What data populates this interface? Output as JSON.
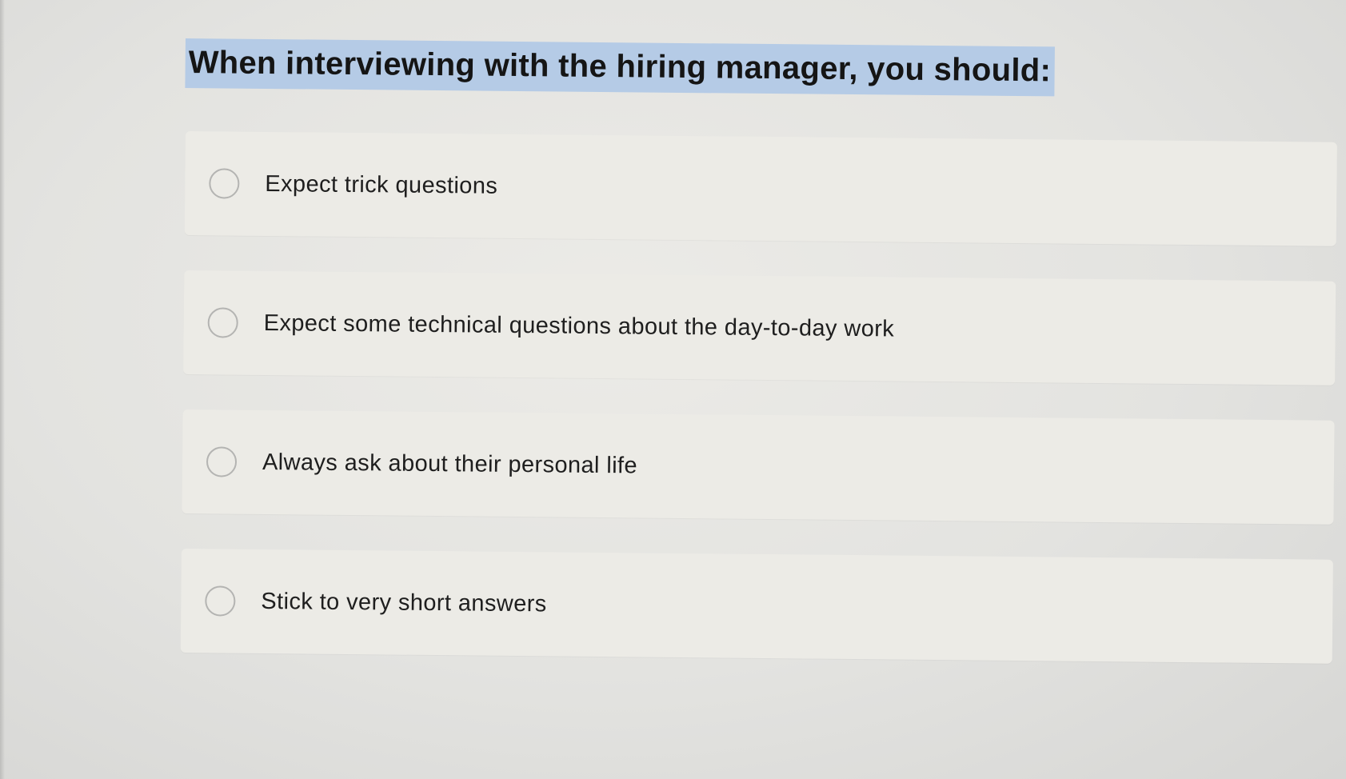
{
  "question": {
    "text": "When interviewing with the hiring manager, you should:"
  },
  "options": [
    {
      "label": "Expect trick questions",
      "selected": false
    },
    {
      "label": "Expect some technical questions about the day-to-day work",
      "selected": false
    },
    {
      "label": "Always ask about their personal life",
      "selected": false
    },
    {
      "label": "Stick to very short answers",
      "selected": false
    }
  ],
  "colors": {
    "highlight": "#b5cbe6",
    "option_background": "#ecebe6",
    "radio_border": "#b4b4b2",
    "text": "#1e1e1e"
  }
}
